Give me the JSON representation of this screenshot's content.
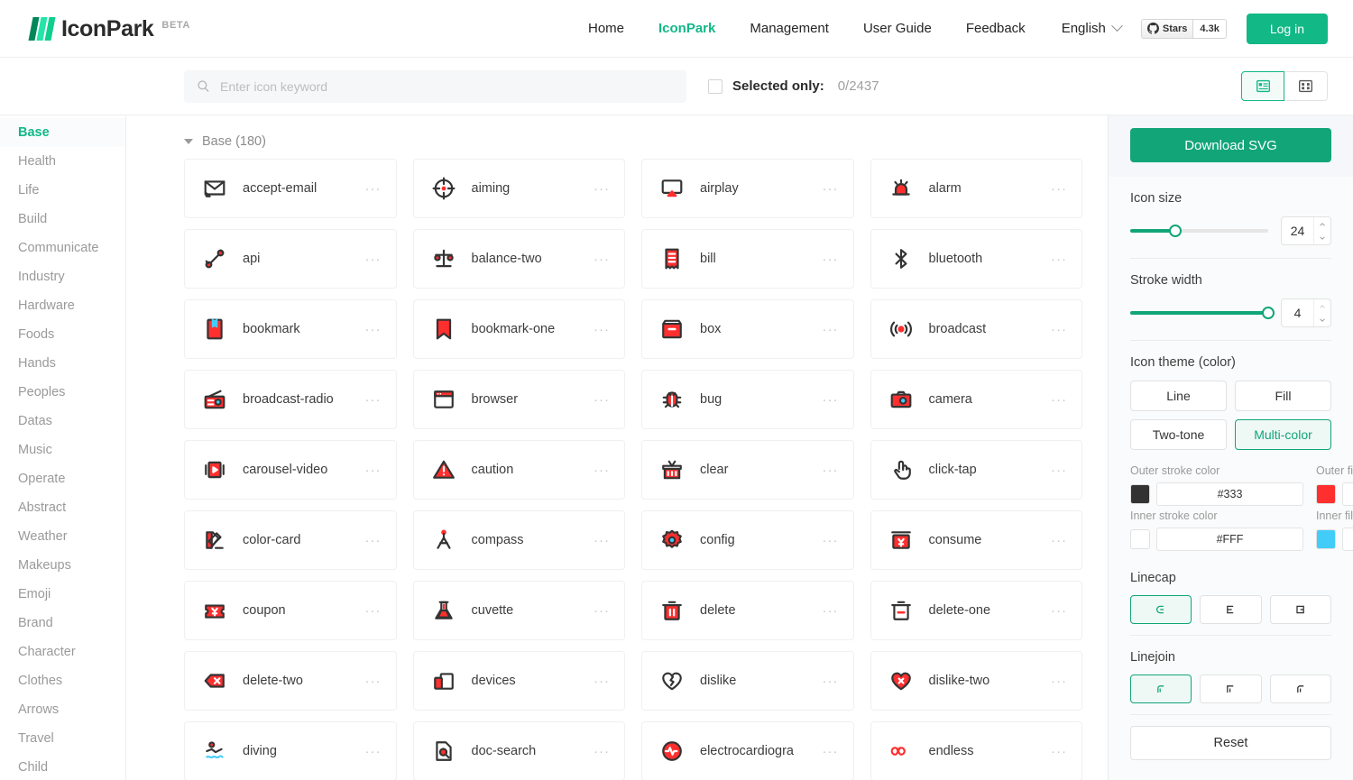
{
  "header": {
    "logo_text": "IconPark",
    "beta_tag": "BETA",
    "nav": [
      {
        "label": "Home",
        "active": false
      },
      {
        "label": "IconPark",
        "active": true
      },
      {
        "label": "Management",
        "active": false
      },
      {
        "label": "User Guide",
        "active": false
      },
      {
        "label": "Feedback",
        "active": false
      }
    ],
    "language": "English",
    "github": {
      "label": "Stars",
      "count": "4.3k"
    },
    "login_label": "Log in"
  },
  "toolbar": {
    "search_placeholder": "Enter icon keyword",
    "search_value": "",
    "selected_only_label": "Selected only:",
    "selected_count": "0/2437",
    "views": [
      {
        "name": "list-view",
        "active": true
      },
      {
        "name": "grid-view",
        "active": false
      }
    ]
  },
  "sidebar": {
    "items": [
      {
        "label": "Base",
        "active": true
      },
      {
        "label": "Health",
        "active": false
      },
      {
        "label": "Life",
        "active": false
      },
      {
        "label": "Build",
        "active": false
      },
      {
        "label": "Communicate",
        "active": false
      },
      {
        "label": "Industry",
        "active": false
      },
      {
        "label": "Hardware",
        "active": false
      },
      {
        "label": "Foods",
        "active": false
      },
      {
        "label": "Hands",
        "active": false
      },
      {
        "label": "Peoples",
        "active": false
      },
      {
        "label": "Datas",
        "active": false
      },
      {
        "label": "Music",
        "active": false
      },
      {
        "label": "Operate",
        "active": false
      },
      {
        "label": "Abstract",
        "active": false
      },
      {
        "label": "Weather",
        "active": false
      },
      {
        "label": "Makeups",
        "active": false
      },
      {
        "label": "Emoji",
        "active": false
      },
      {
        "label": "Brand",
        "active": false
      },
      {
        "label": "Character",
        "active": false
      },
      {
        "label": "Clothes",
        "active": false
      },
      {
        "label": "Arrows",
        "active": false
      },
      {
        "label": "Travel",
        "active": false
      },
      {
        "label": "Child",
        "active": false
      }
    ]
  },
  "main": {
    "section_title": "Base (180)",
    "menu_dots": "···",
    "icons": [
      {
        "name": "accept-email",
        "icon": "accept-email-icon"
      },
      {
        "name": "aiming",
        "icon": "aiming-icon"
      },
      {
        "name": "airplay",
        "icon": "airplay-icon"
      },
      {
        "name": "alarm",
        "icon": "alarm-icon"
      },
      {
        "name": "api",
        "icon": "api-icon"
      },
      {
        "name": "balance-two",
        "icon": "balance-two-icon"
      },
      {
        "name": "bill",
        "icon": "bill-icon"
      },
      {
        "name": "bluetooth",
        "icon": "bluetooth-icon"
      },
      {
        "name": "bookmark",
        "icon": "bookmark-icon"
      },
      {
        "name": "bookmark-one",
        "icon": "bookmark-one-icon"
      },
      {
        "name": "box",
        "icon": "box-icon"
      },
      {
        "name": "broadcast",
        "icon": "broadcast-icon"
      },
      {
        "name": "broadcast-radio",
        "icon": "broadcast-radio-icon"
      },
      {
        "name": "browser",
        "icon": "browser-icon"
      },
      {
        "name": "bug",
        "icon": "bug-icon"
      },
      {
        "name": "camera",
        "icon": "camera-icon"
      },
      {
        "name": "carousel-video",
        "icon": "carousel-video-icon"
      },
      {
        "name": "caution",
        "icon": "caution-icon"
      },
      {
        "name": "clear",
        "icon": "clear-icon"
      },
      {
        "name": "click-tap",
        "icon": "click-tap-icon"
      },
      {
        "name": "color-card",
        "icon": "color-card-icon"
      },
      {
        "name": "compass",
        "icon": "compass-icon"
      },
      {
        "name": "config",
        "icon": "config-icon"
      },
      {
        "name": "consume",
        "icon": "consume-icon"
      },
      {
        "name": "coupon",
        "icon": "coupon-icon"
      },
      {
        "name": "cuvette",
        "icon": "cuvette-icon"
      },
      {
        "name": "delete",
        "icon": "delete-icon"
      },
      {
        "name": "delete-one",
        "icon": "delete-one-icon"
      },
      {
        "name": "delete-two",
        "icon": "delete-two-icon"
      },
      {
        "name": "devices",
        "icon": "devices-icon"
      },
      {
        "name": "dislike",
        "icon": "dislike-icon"
      },
      {
        "name": "dislike-two",
        "icon": "dislike-two-icon"
      },
      {
        "name": "diving",
        "icon": "diving-icon"
      },
      {
        "name": "doc-search",
        "icon": "doc-search-icon"
      },
      {
        "name": "electrocardiogra",
        "icon": "electrocardiogram-icon"
      },
      {
        "name": "endless",
        "icon": "endless-icon"
      }
    ]
  },
  "panel": {
    "download_label": "Download SVG",
    "icon_size": {
      "label": "Icon size",
      "value": "24",
      "percent": 33
    },
    "stroke_width": {
      "label": "Stroke width",
      "value": "4",
      "percent": 100
    },
    "theme": {
      "label": "Icon theme (color)",
      "options": [
        {
          "label": "Line",
          "active": false
        },
        {
          "label": "Fill",
          "active": false
        },
        {
          "label": "Two-tone",
          "active": false
        },
        {
          "label": "Multi-color",
          "active": true
        }
      ],
      "colors": [
        {
          "label": "Outer stroke color",
          "value": "#333",
          "swatch": "#333333"
        },
        {
          "label": "Outer fill color",
          "value": "#ff2f2f",
          "swatch": "#ff2f2f"
        },
        {
          "label": "Inner stroke color",
          "value": "#FFF",
          "swatch": "#FFFFFF"
        },
        {
          "label": "Inner fill color",
          "value": "#43CCF8",
          "swatch": "#43CCF8"
        }
      ]
    },
    "linecap": {
      "label": "Linecap",
      "options": [
        {
          "name": "linecap-round",
          "active": true
        },
        {
          "name": "linecap-butt",
          "active": false
        },
        {
          "name": "linecap-square",
          "active": false
        }
      ]
    },
    "linejoin": {
      "label": "Linejoin",
      "options": [
        {
          "name": "linejoin-round",
          "active": true
        },
        {
          "name": "linejoin-miter",
          "active": false
        },
        {
          "name": "linejoin-bevel",
          "active": false
        }
      ]
    },
    "reset_label": "Reset"
  },
  "colors": {
    "accent": "#12b886",
    "accent_dark": "#12a578",
    "icon_fill": "#ff2f2f",
    "icon_stroke": "#333333",
    "icon_inner": "#43CCF8"
  }
}
